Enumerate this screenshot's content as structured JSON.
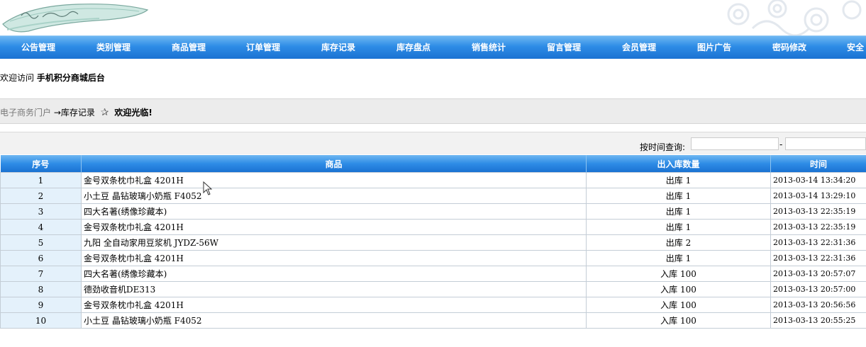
{
  "nav": {
    "items": [
      {
        "label": "公告管理"
      },
      {
        "label": "类别管理"
      },
      {
        "label": "商品管理"
      },
      {
        "label": "订单管理"
      },
      {
        "label": "库存记录"
      },
      {
        "label": "库存盘点"
      },
      {
        "label": "销售统计"
      },
      {
        "label": "留言管理"
      },
      {
        "label": "会员管理"
      },
      {
        "label": "图片广告"
      },
      {
        "label": "密码修改"
      },
      {
        "label": "安全"
      }
    ]
  },
  "welcome": {
    "prefix": "欢迎访问",
    "site": "手机积分商城后台"
  },
  "breadcrumb": {
    "home": "电子商务门户",
    "arrow": "→",
    "current": "库存记录",
    "greeting": "欢迎光临!"
  },
  "search": {
    "label": "按时间查询:",
    "separator": "-"
  },
  "table": {
    "headers": [
      "序号",
      "商品",
      "出入库数量",
      "时间"
    ],
    "rows": [
      {
        "idx": "1",
        "product": "金号双条枕巾礼盒 4201H",
        "qty": "出库 1",
        "time": "2013-03-14 13:34:20"
      },
      {
        "idx": "2",
        "product": "小土豆 晶钻玻璃小奶瓶 F4052",
        "qty": "出库 1",
        "time": "2013-03-14 13:29:10"
      },
      {
        "idx": "3",
        "product": "四大名著(绣像珍藏本)",
        "qty": "出库 1",
        "time": "2013-03-13 22:35:19"
      },
      {
        "idx": "4",
        "product": "金号双条枕巾礼盒 4201H",
        "qty": "出库 1",
        "time": "2013-03-13 22:35:19"
      },
      {
        "idx": "5",
        "product": "九阳 全自动家用豆浆机 JYDZ-56W",
        "qty": "出库 2",
        "time": "2013-03-13 22:31:36"
      },
      {
        "idx": "6",
        "product": "金号双条枕巾礼盒 4201H",
        "qty": "出库 1",
        "time": "2013-03-13 22:31:36"
      },
      {
        "idx": "7",
        "product": "四大名著(绣像珍藏本)",
        "qty": "入库 100",
        "time": "2013-03-13 20:57:07"
      },
      {
        "idx": "8",
        "product": "德劲收音机DE313",
        "qty": "入库 100",
        "time": "2013-03-13 20:57:00"
      },
      {
        "idx": "9",
        "product": "金号双条枕巾礼盒 4201H",
        "qty": "入库 100",
        "time": "2013-03-13 20:56:56"
      },
      {
        "idx": "10",
        "product": "小土豆 晶钻玻璃小奶瓶 F4052",
        "qty": "入库 100",
        "time": "2013-03-13 20:55:25"
      }
    ]
  },
  "colors": {
    "nav": "#2e8ce6",
    "index_cell": "#e4f1fb",
    "crumb_bar": "#ececec"
  }
}
